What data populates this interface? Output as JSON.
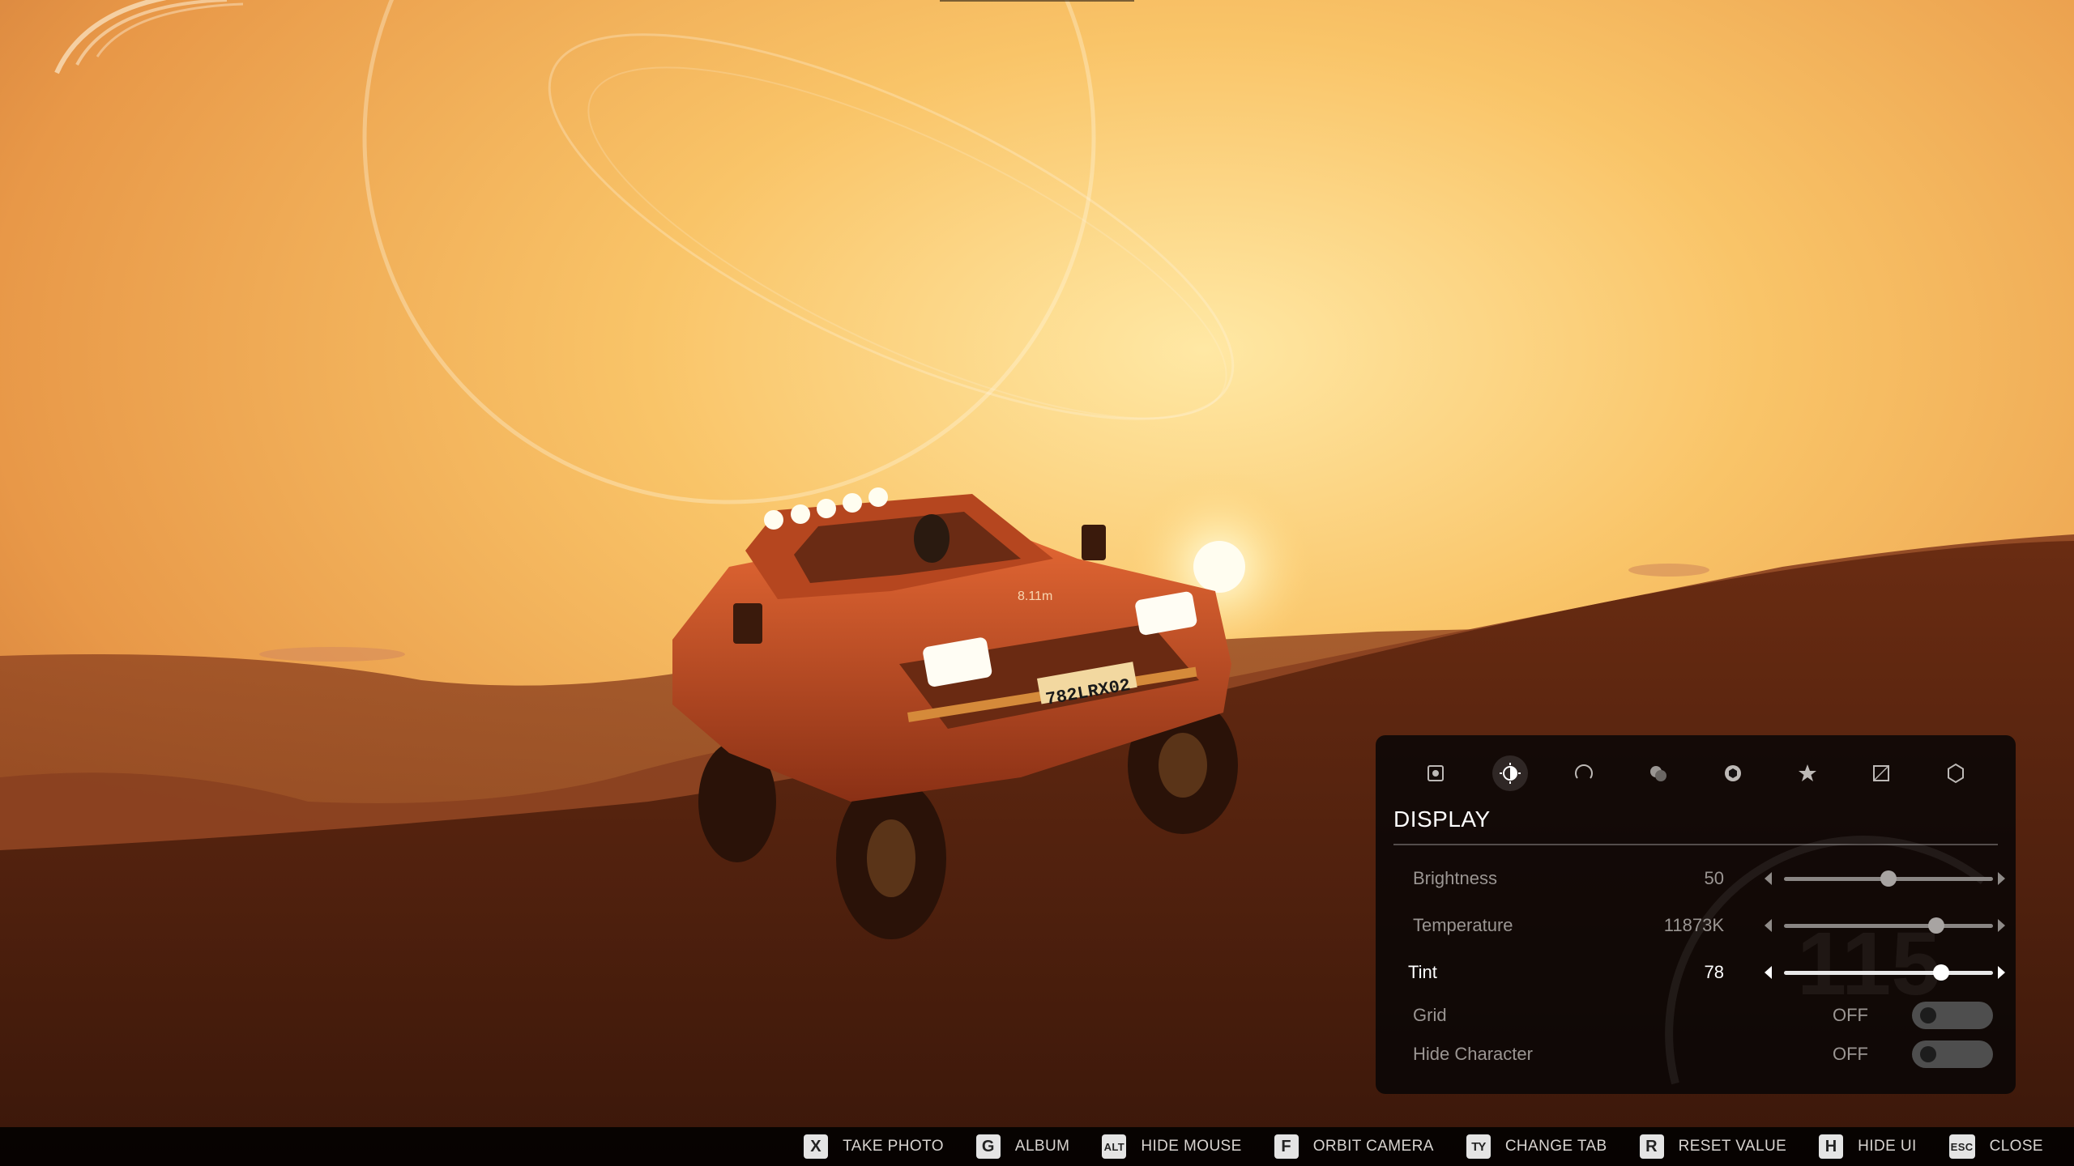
{
  "hud": {
    "distance": "8.11m"
  },
  "plate": "782LRX02",
  "panel": {
    "tabs": [
      {
        "icon": "camera-square-icon",
        "active": false
      },
      {
        "icon": "contrast-icon",
        "active": true
      },
      {
        "icon": "circle-arc-icon",
        "active": false
      },
      {
        "icon": "color-blend-icon",
        "active": false
      },
      {
        "icon": "aperture-icon",
        "active": false
      },
      {
        "icon": "star-icon",
        "active": false
      },
      {
        "icon": "frame-corner-icon",
        "active": false
      },
      {
        "icon": "hexagon-icon",
        "active": false
      }
    ],
    "title": "DISPLAY",
    "sliders": {
      "brightness": {
        "label": "Brightness",
        "value": "50",
        "level": 0.5
      },
      "temperature": {
        "label": "Temperature",
        "value": "11873K",
        "level": 0.73
      },
      "tint": {
        "label": "Tint",
        "value": "78",
        "level": 0.75
      }
    },
    "toggles": {
      "grid": {
        "label": "Grid",
        "value": "OFF"
      },
      "hide_character": {
        "label": "Hide Character",
        "value": "OFF"
      }
    }
  },
  "hints": [
    {
      "key": "X",
      "label": "TAKE PHOTO"
    },
    {
      "key": "G",
      "label": "ALBUM"
    },
    {
      "key": "ALT",
      "label": "HIDE MOUSE"
    },
    {
      "key": "F",
      "label": "ORBIT CAMERA"
    },
    {
      "key": "TY",
      "label": "CHANGE TAB"
    },
    {
      "key": "R",
      "label": "RESET VALUE"
    },
    {
      "key": "H",
      "label": "HIDE UI"
    },
    {
      "key": "ESC",
      "label": "CLOSE"
    }
  ]
}
